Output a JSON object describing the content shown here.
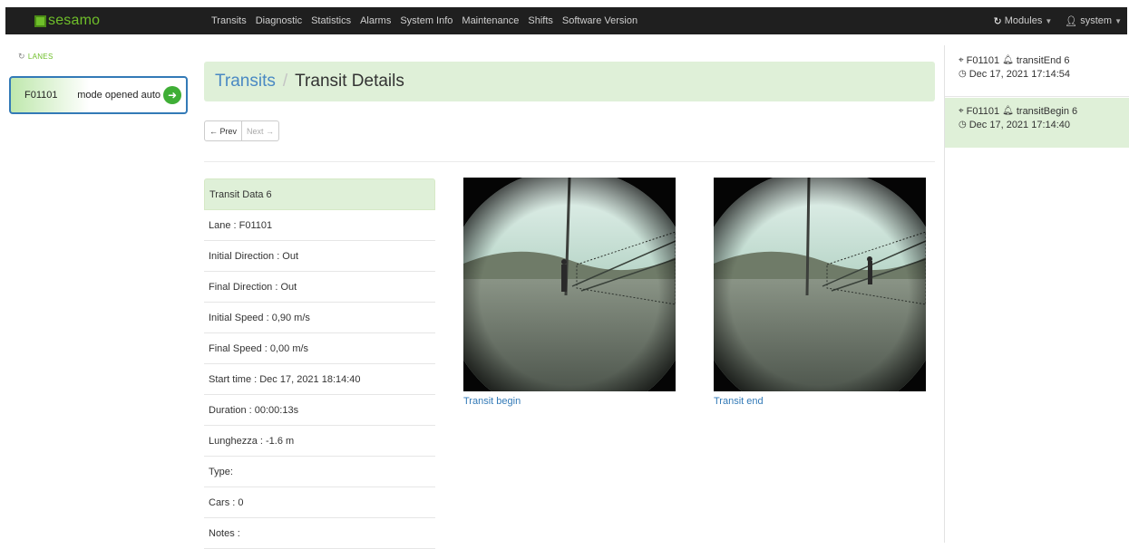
{
  "brand": {
    "name": "sesamo"
  },
  "nav": {
    "items": [
      "Transits",
      "Diagnostic",
      "Statistics",
      "Alarms",
      "System Info",
      "Maintenance",
      "Shifts",
      "Software Version"
    ],
    "modules_label": "Modules",
    "user_label": "system"
  },
  "sidebar": {
    "heading": "LANES",
    "lane": {
      "id": "F01101",
      "mode": "mode opened auto"
    }
  },
  "breadcrumb": {
    "parent": "Transits",
    "current": "Transit Details"
  },
  "pager": {
    "prev": "← Prev",
    "next": "Next →"
  },
  "transit": {
    "heading": "Transit Data 6",
    "rows": [
      "Lane : F01101",
      "Initial Direction : Out",
      "Final Direction : Out",
      "Initial Speed : 0,90 m/s",
      "Final Speed : 0,00 m/s",
      "Start time : Dec 17, 2021 18:14:40",
      "Duration : 00:00:13s",
      "Lunghezza : -1.6 m",
      "Type:",
      "Cars : 0",
      "Notes :"
    ]
  },
  "images": {
    "begin_caption": "Transit begin",
    "end_caption": "Transit end"
  },
  "events": [
    {
      "lane": "F01101",
      "event": "transitEnd 6",
      "time": "Dec 17, 2021 17:14:54"
    },
    {
      "lane": "F01101",
      "event": "transitBegin 6",
      "time": "Dec 17, 2021 17:14:40"
    }
  ],
  "icons": {
    "brand": "square-logo-icon",
    "modules": "modules-icon",
    "user": "user-icon",
    "lanes": "refresh-icon",
    "lane_status": "arrow-right-circle-icon",
    "event_lane": "map-marker-icon",
    "event_type": "bell-icon",
    "event_time": "clock-icon"
  },
  "colors": {
    "accent_green": "#6fbf2a",
    "panel_green": "#dff0d8",
    "link_blue": "#337ab7",
    "navbar": "#1f1f1f"
  }
}
